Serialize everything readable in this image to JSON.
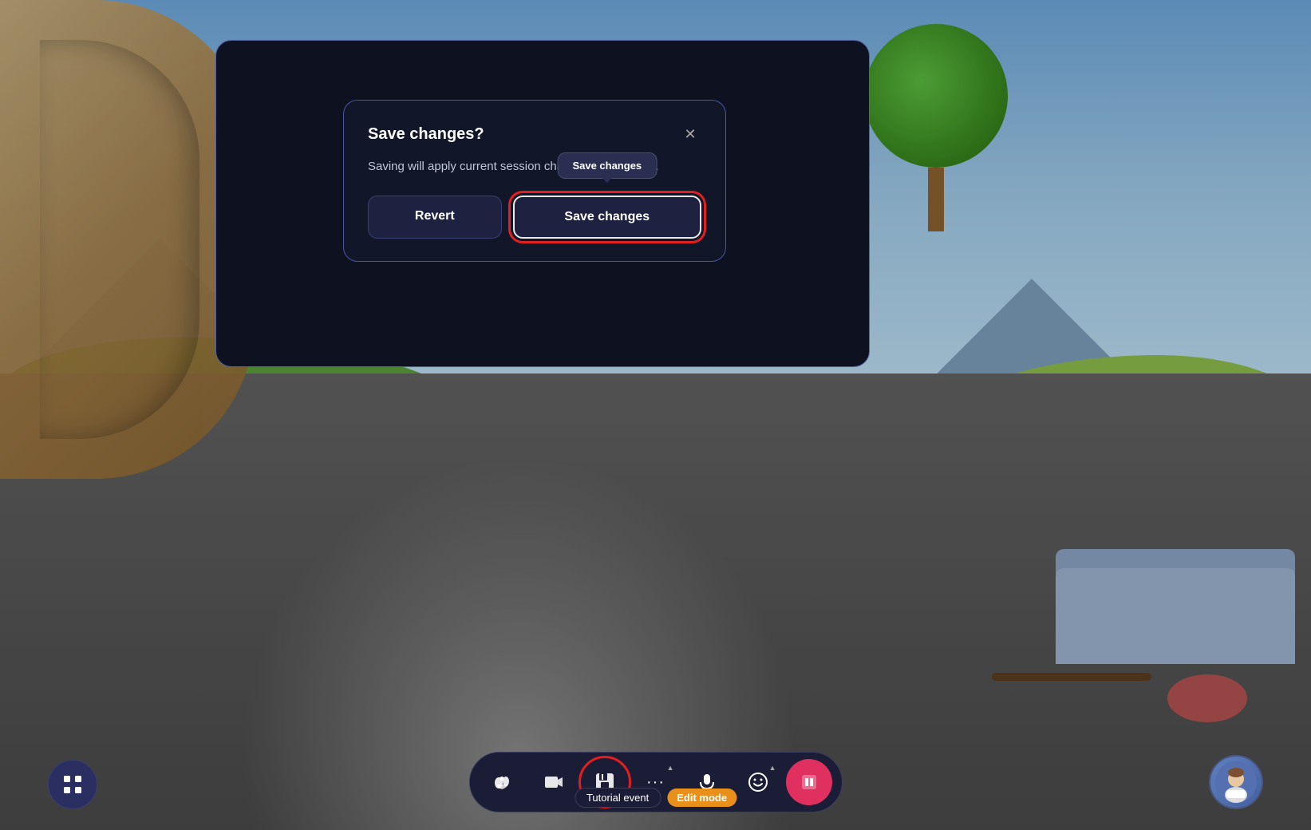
{
  "scene": {
    "bg_desc": "Virtual meeting room with outdoor landscape"
  },
  "dialog": {
    "title": "Save changes?",
    "body": "Saving will apply current session changes to the event.",
    "close_label": "✕",
    "revert_label": "Revert",
    "save_label": "Save changes",
    "tooltip_label": "Save changes"
  },
  "toolbar": {
    "apps_icon": "⊞",
    "btn_hands_label": "hands",
    "btn_media_label": "media",
    "btn_save_label": "save",
    "btn_more_label": "···",
    "btn_mic_label": "mic",
    "btn_emoji_label": "emoji",
    "btn_phone_label": "phone",
    "event_name": "Tutorial event",
    "edit_mode_label": "Edit mode"
  },
  "avatar": {
    "label": "user-avatar"
  }
}
